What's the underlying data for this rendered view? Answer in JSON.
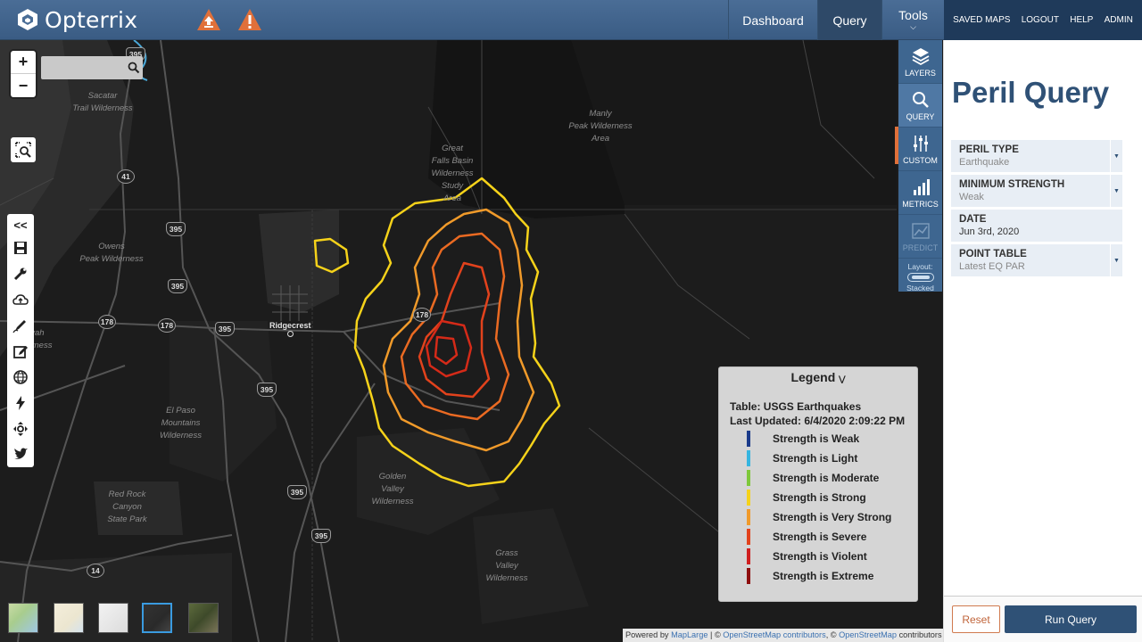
{
  "header": {
    "app_name": "Opterrix",
    "logo_icon": "opterrix-logo-icon",
    "alert_icons": [
      "upload-warning-icon",
      "alert-warning-icon"
    ],
    "nav": [
      {
        "label": "Dashboard"
      },
      {
        "label": "Query",
        "active": true
      },
      {
        "label": "Tools"
      }
    ],
    "top_links": [
      "SAVED MAPS",
      "LOGOUT",
      "HELP",
      "ADMIN"
    ],
    "accent_color": "#e0703a"
  },
  "map": {
    "search_placeholder": "",
    "zoom_in": "+",
    "zoom_out": "−",
    "toolbar_collapse": "<<",
    "city": "Ridgecrest",
    "labels": [
      {
        "text": "Sacatar\nTrail Wilderness"
      },
      {
        "text": "Owens\nPeak Wilderness"
      },
      {
        "text": "Manly\nPeak Wilderness\nArea"
      },
      {
        "text": "Great\nFalls Basin\nWilderness\nStudy\nArea"
      },
      {
        "text": "El Paso\nMountains\nWilderness"
      },
      {
        "text": "Red Rock\nCanyon\nState Park"
      },
      {
        "text": "Golden\nValley\nWilderness"
      },
      {
        "text": "Grass\nValley\nWilderness"
      },
      {
        "text": "Kiavah\nWilderness"
      }
    ],
    "shields": [
      "395",
      "395",
      "395",
      "395",
      "395",
      "395",
      "395",
      "41",
      "178",
      "178",
      "178",
      "14"
    ],
    "basemaps": [
      "streets",
      "light",
      "gray",
      "dark",
      "satellite"
    ],
    "selected_basemap": "dark",
    "contour_colors": [
      "#f5d21a",
      "#f09a2a",
      "#ea6a22",
      "#e2421c",
      "#d52a18"
    ]
  },
  "map_tabs": [
    {
      "label": "LAYERS",
      "icon": "layers-icon"
    },
    {
      "label": "QUERY",
      "icon": "search-icon",
      "active": true
    },
    {
      "label": "CUSTOM",
      "icon": "sliders-icon"
    },
    {
      "label": "METRICS",
      "icon": "bar-chart-icon"
    },
    {
      "label": "PREDICT",
      "icon": "predict-chart-icon",
      "disabled": true
    }
  ],
  "layout": {
    "label": "Layout:",
    "value": "Stacked"
  },
  "legend": {
    "title": "Legend",
    "table": "Table: USGS Earthquakes",
    "updated": "Last Updated: 6/4/2020 2:09:22 PM",
    "items": [
      {
        "label": "Strength is Weak",
        "color": "#1a3a8a"
      },
      {
        "label": "Strength is Light",
        "color": "#35b5e0"
      },
      {
        "label": "Strength is Moderate",
        "color": "#7ec83a"
      },
      {
        "label": "Strength is Strong",
        "color": "#f5d21a"
      },
      {
        "label": "Strength is Very Strong",
        "color": "#f09a2a"
      },
      {
        "label": "Strength is Severe",
        "color": "#e2421c"
      },
      {
        "label": "Strength is Violent",
        "color": "#cf1f1f"
      },
      {
        "label": "Strength is Extreme",
        "color": "#8e0e0e"
      }
    ]
  },
  "attribution": {
    "prefix": "Powered by ",
    "provider": "MapLarge",
    "sep1": " | © ",
    "osm1": "OpenStreetMap contributors",
    "sep2": ", © ",
    "osm2": "OpenStreetMap",
    "suffix": " contributors"
  },
  "panel": {
    "title": "Peril Query",
    "fields": [
      {
        "label": "PERIL TYPE",
        "value": "Earthquake",
        "dropdown": true
      },
      {
        "label": "MINIMUM STRENGTH",
        "value": "Weak",
        "dropdown": true
      },
      {
        "label": "DATE",
        "value": "Jun 3rd, 2020",
        "dropdown": false
      },
      {
        "label": "POINT TABLE",
        "value": "Latest EQ PAR",
        "dropdown": true
      }
    ],
    "reset": "Reset",
    "run": "Run Query",
    "theme_color": "#2f5176"
  }
}
